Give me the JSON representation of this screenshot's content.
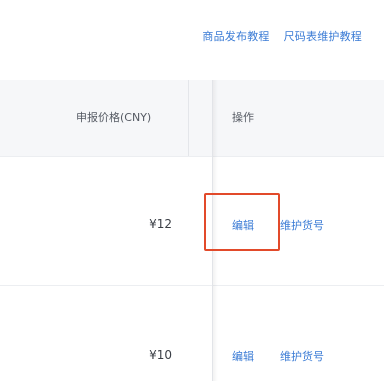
{
  "help_links": {
    "product_publish_tutorial": "商品发布教程",
    "size_table_maintenance_tutorial": "尺码表维护教程"
  },
  "table": {
    "headers": {
      "price": "申报价格(CNY)",
      "actions": "操作"
    },
    "rows": [
      {
        "price": "¥12",
        "edit": "编辑",
        "maintain_sku": "维护货号"
      },
      {
        "price": "¥10",
        "edit": "编辑",
        "maintain_sku": "维护货号"
      }
    ]
  },
  "colors": {
    "link": "#3a7bd5",
    "highlight": "#e24a2a",
    "header_bg": "#f6f7f9"
  }
}
